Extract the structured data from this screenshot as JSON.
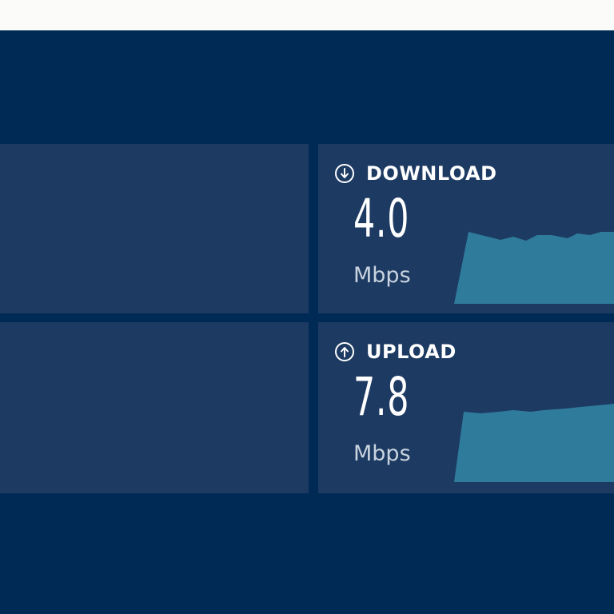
{
  "colors": {
    "page_background": "#002a56",
    "top_strip": "#fbfbf9",
    "panel_background": "#1d3a62",
    "graph_fill": "#2f7b9b",
    "text_primary": "#ffffff",
    "text_secondary": "#c9d3df"
  },
  "download": {
    "label": "DOWNLOAD",
    "value": "4.0",
    "unit": "Mbps",
    "icon": "download-arrow-icon"
  },
  "upload": {
    "label": "UPLOAD",
    "value": "7.8",
    "unit": "Mbps",
    "icon": "upload-arrow-icon"
  }
}
